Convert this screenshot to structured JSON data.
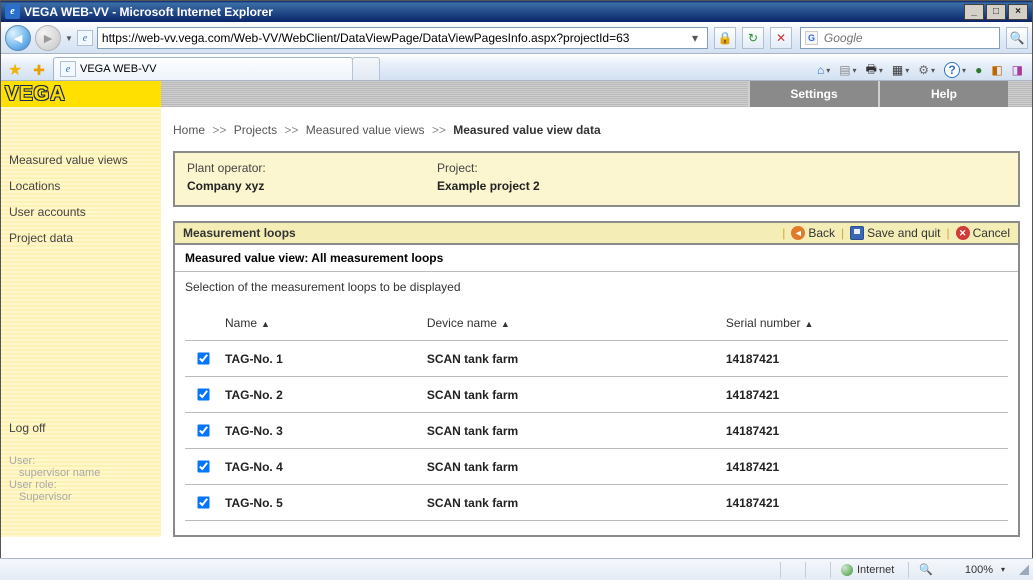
{
  "window": {
    "title": "VEGA WEB-VV - Microsoft Internet Explorer",
    "url": "https://web-vv.vega.com/Web-VV/WebClient/DataViewPage/DataViewPagesInfo.aspx?projectId=63",
    "search_placeholder": "Google",
    "tab_title": "VEGA WEB-VV"
  },
  "header": {
    "logo_text": "VEGA",
    "settings_label": "Settings",
    "help_label": "Help"
  },
  "sidebar": {
    "items": [
      {
        "label": "Measured value views"
      },
      {
        "label": "Locations"
      },
      {
        "label": "User accounts"
      },
      {
        "label": "Project data"
      }
    ],
    "logoff_label": "Log off",
    "user_label": "User:",
    "user_value": "supervisor name",
    "role_label": "User role:",
    "role_value": "Supervisor"
  },
  "breadcrumb": {
    "home": "Home",
    "projects": "Projects",
    "views": "Measured value views",
    "current": "Measured value view data",
    "sep": ">>"
  },
  "info": {
    "plant_operator_label": "Plant operator:",
    "plant_operator_value": "Company xyz",
    "project_label": "Project:",
    "project_value": "Example project 2"
  },
  "panel": {
    "title": "Measurement loops",
    "back_label": "Back",
    "save_label": "Save and quit",
    "cancel_label": "Cancel",
    "subtitle": "Measured value view: All measurement loops",
    "desc": "Selection of the measurement loops to be displayed",
    "col_name": "Name",
    "col_device": "Device name",
    "col_serial": "Serial number",
    "rows": [
      {
        "name": "TAG-No. 1",
        "device": "SCAN tank farm",
        "serial": "14187421"
      },
      {
        "name": "TAG-No. 2",
        "device": "SCAN tank farm",
        "serial": "14187421"
      },
      {
        "name": "TAG-No. 3",
        "device": "SCAN tank farm",
        "serial": "14187421"
      },
      {
        "name": "TAG-No. 4",
        "device": "SCAN tank farm",
        "serial": "14187421"
      },
      {
        "name": "TAG-No. 5",
        "device": "SCAN tank farm",
        "serial": "14187421"
      }
    ]
  },
  "status": {
    "zone": "Internet",
    "zoom": "100%"
  }
}
